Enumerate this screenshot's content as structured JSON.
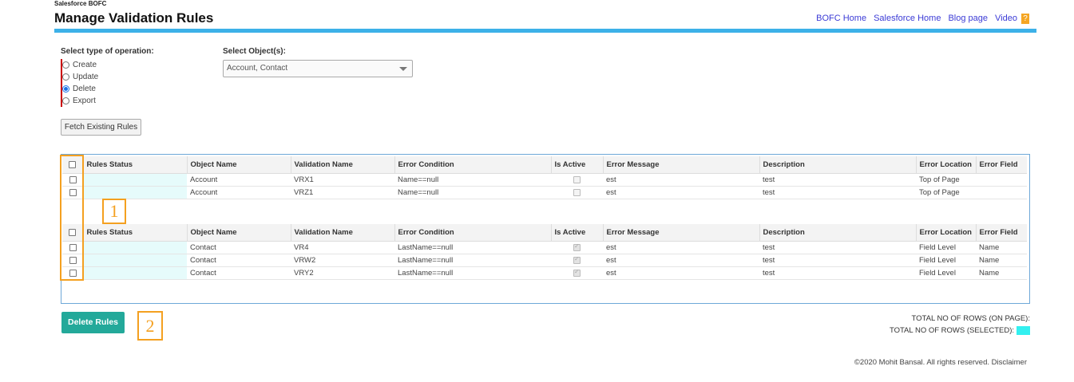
{
  "app": {
    "name": "Salesforce BOFC",
    "title": "Manage Validation Rules"
  },
  "top_links": [
    "BOFC Home",
    "Salesforce Home",
    "Blog page",
    "Video"
  ],
  "video_badge": "?",
  "operation": {
    "label": "Select type of operation:",
    "options": [
      "Create",
      "Update",
      "Delete",
      "Export"
    ],
    "selected": "Delete"
  },
  "objects": {
    "label": "Select Object(s):",
    "value": "Account, Contact"
  },
  "fetch_button": "Fetch Existing Rules",
  "table": {
    "columns": [
      "Rules Status",
      "Object Name",
      "Validation Name",
      "Error Condition",
      "Is Active",
      "Error Message",
      "Description",
      "Error Location",
      "Error Field"
    ]
  },
  "groups": [
    {
      "rows": [
        {
          "status": "",
          "object": "Account",
          "validation": "VRX1",
          "condition": "Name==null",
          "active": false,
          "message": "est",
          "description": "test",
          "location": "Top of Page",
          "field": ""
        },
        {
          "status": "",
          "object": "Account",
          "validation": "VRZ1",
          "condition": "Name==null",
          "active": false,
          "message": "est",
          "description": "test",
          "location": "Top of Page",
          "field": ""
        }
      ]
    },
    {
      "rows": [
        {
          "status": "",
          "object": "Contact",
          "validation": "VR4",
          "condition": "LastName==null",
          "active": true,
          "message": "est",
          "description": "test",
          "location": "Field Level",
          "field": "Name"
        },
        {
          "status": "",
          "object": "Contact",
          "validation": "VRW2",
          "condition": "LastName==null",
          "active": true,
          "message": "est",
          "description": "test",
          "location": "Field Level",
          "field": "Name"
        },
        {
          "status": "",
          "object": "Contact",
          "validation": "VRY2",
          "condition": "LastName==null",
          "active": true,
          "message": "est",
          "description": "test",
          "location": "Field Level",
          "field": "Name"
        }
      ]
    }
  ],
  "annotations": [
    "1",
    "2"
  ],
  "delete_button": "Delete Rules",
  "totals": {
    "on_page": "TOTAL NO OF ROWS (ON PAGE):",
    "selected": "TOTAL NO OF ROWS (SELECTED):"
  },
  "footer": "©2020 Mohit Bansal. All rights reserved. Disclaimer",
  "colors": {
    "accent_bar": "#3db1e8",
    "delete_button": "#23a99a",
    "annotation": "#f4a020",
    "selected_indicator": "#33f0f0"
  }
}
